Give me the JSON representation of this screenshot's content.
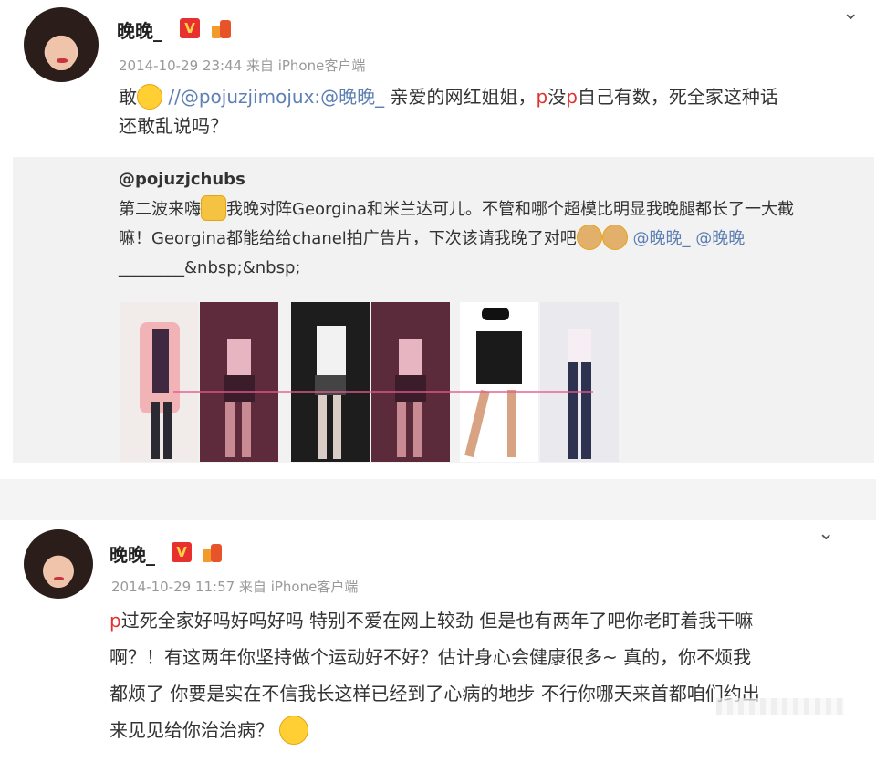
{
  "post1": {
    "username": "晚晚_",
    "vip_badge": "V",
    "meta": "2014-10-29 23:44 来自 iPhone客户端",
    "text_prefix": "敢",
    "text_link": "//@pojuzjimojux:@晚晚_",
    "text_mid": " 亲爱的网红姐姐，",
    "text_red": "p",
    "text_mid2": "没",
    "text_red2": "p",
    "text_rest": "自己有数，死全家这种话",
    "text_line2": "还敢乱说吗？",
    "repost": {
      "user": "@pojuzjchubs",
      "line1_a": "第二波来嗨",
      "line1_b": "我晚对阵Georgina和米兰达可儿。不管和哪个超模比明显我晚腿都长了一大截",
      "line2_a": "嘛！Georgina都能给给chanel拍广告片，下次该请我晚了对吧",
      "line2_links": "@晚晚_ @晚晚",
      "line3": "________&nbsp;&nbsp;"
    }
  },
  "post2": {
    "username": "晚晚_",
    "vip_badge": "V",
    "meta": "2014-10-29 11:57 来自 iPhone客户端",
    "line1_red": "p",
    "line1": "过死全家好吗好吗好吗 特别不爱在网上较劲 但是也有两年了吧你老盯着我干嘛",
    "line2": "啊？！有这两年你坚持做个运动好不好？估计身心会健康很多~ 真的，你不烦我",
    "line3": "都烦了 你要是实在不信我长这样已经到了心病的地步 不行你哪天来首都咱们约出",
    "line4": "来见见给你治治病？"
  },
  "icons": {
    "chevron": "chevron-down-icon",
    "vip": "vip-badge-icon",
    "medal": "medal-icon",
    "emoji": "emoji-icon"
  },
  "colors": {
    "link": "#5d7fb3",
    "vip": "#e8312f",
    "meta": "#999999",
    "repost_bg": "#f2f2f2"
  }
}
